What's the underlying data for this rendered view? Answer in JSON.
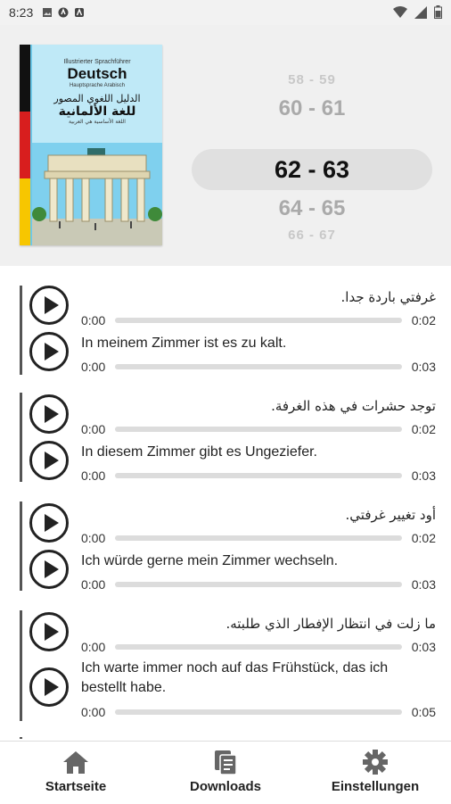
{
  "status": {
    "time": "8:23"
  },
  "book": {
    "subtitle_top": "Illustrierter Sprachführer",
    "title": "Deutsch",
    "subtitle_small": "Hauptsprache Arabisch",
    "arabic_line1": "الدليل اللغوي المصور",
    "arabic_title": "للغة الألمانية",
    "arabic_line3": "اللغة الأساسية هي العربية"
  },
  "picker": {
    "items": [
      "58 - 59",
      "60 - 61",
      "62 - 63",
      "64 - 65",
      "66 - 67"
    ],
    "selected_index": 2
  },
  "groups": [
    {
      "lines": [
        {
          "text": "غرفتي باردة جدا.",
          "start": "0:00",
          "end": "0:02",
          "rtl": true
        },
        {
          "text": "In meinem Zimmer ist es zu kalt.",
          "start": "0:00",
          "end": "0:03",
          "rtl": false
        }
      ]
    },
    {
      "lines": [
        {
          "text": "توجد حشرات في هذه الغرفة.",
          "start": "0:00",
          "end": "0:02",
          "rtl": true
        },
        {
          "text": "In diesem Zimmer gibt es Ungeziefer.",
          "start": "0:00",
          "end": "0:03",
          "rtl": false
        }
      ]
    },
    {
      "lines": [
        {
          "text": "أود تغيير غرفتي.",
          "start": "0:00",
          "end": "0:02",
          "rtl": true
        },
        {
          "text": "Ich würde gerne mein Zimmer wechseln.",
          "start": "0:00",
          "end": "0:03",
          "rtl": false
        }
      ]
    },
    {
      "lines": [
        {
          "text": "ما زلت في انتظار الإفطار الذي طلبته.",
          "start": "0:00",
          "end": "0:03",
          "rtl": true
        },
        {
          "text": "Ich warte immer noch auf das Frühstück, das ich bestellt habe.",
          "start": "0:00",
          "end": "0:05",
          "rtl": false
        }
      ]
    }
  ],
  "nav": {
    "home_label": "Startseite",
    "downloads_label": "Downloads",
    "settings_label": "Einstellungen"
  },
  "colors": {
    "accent": "#222222",
    "header_bg": "#f0f0f0",
    "selected_pill": "#e0e0e0"
  }
}
